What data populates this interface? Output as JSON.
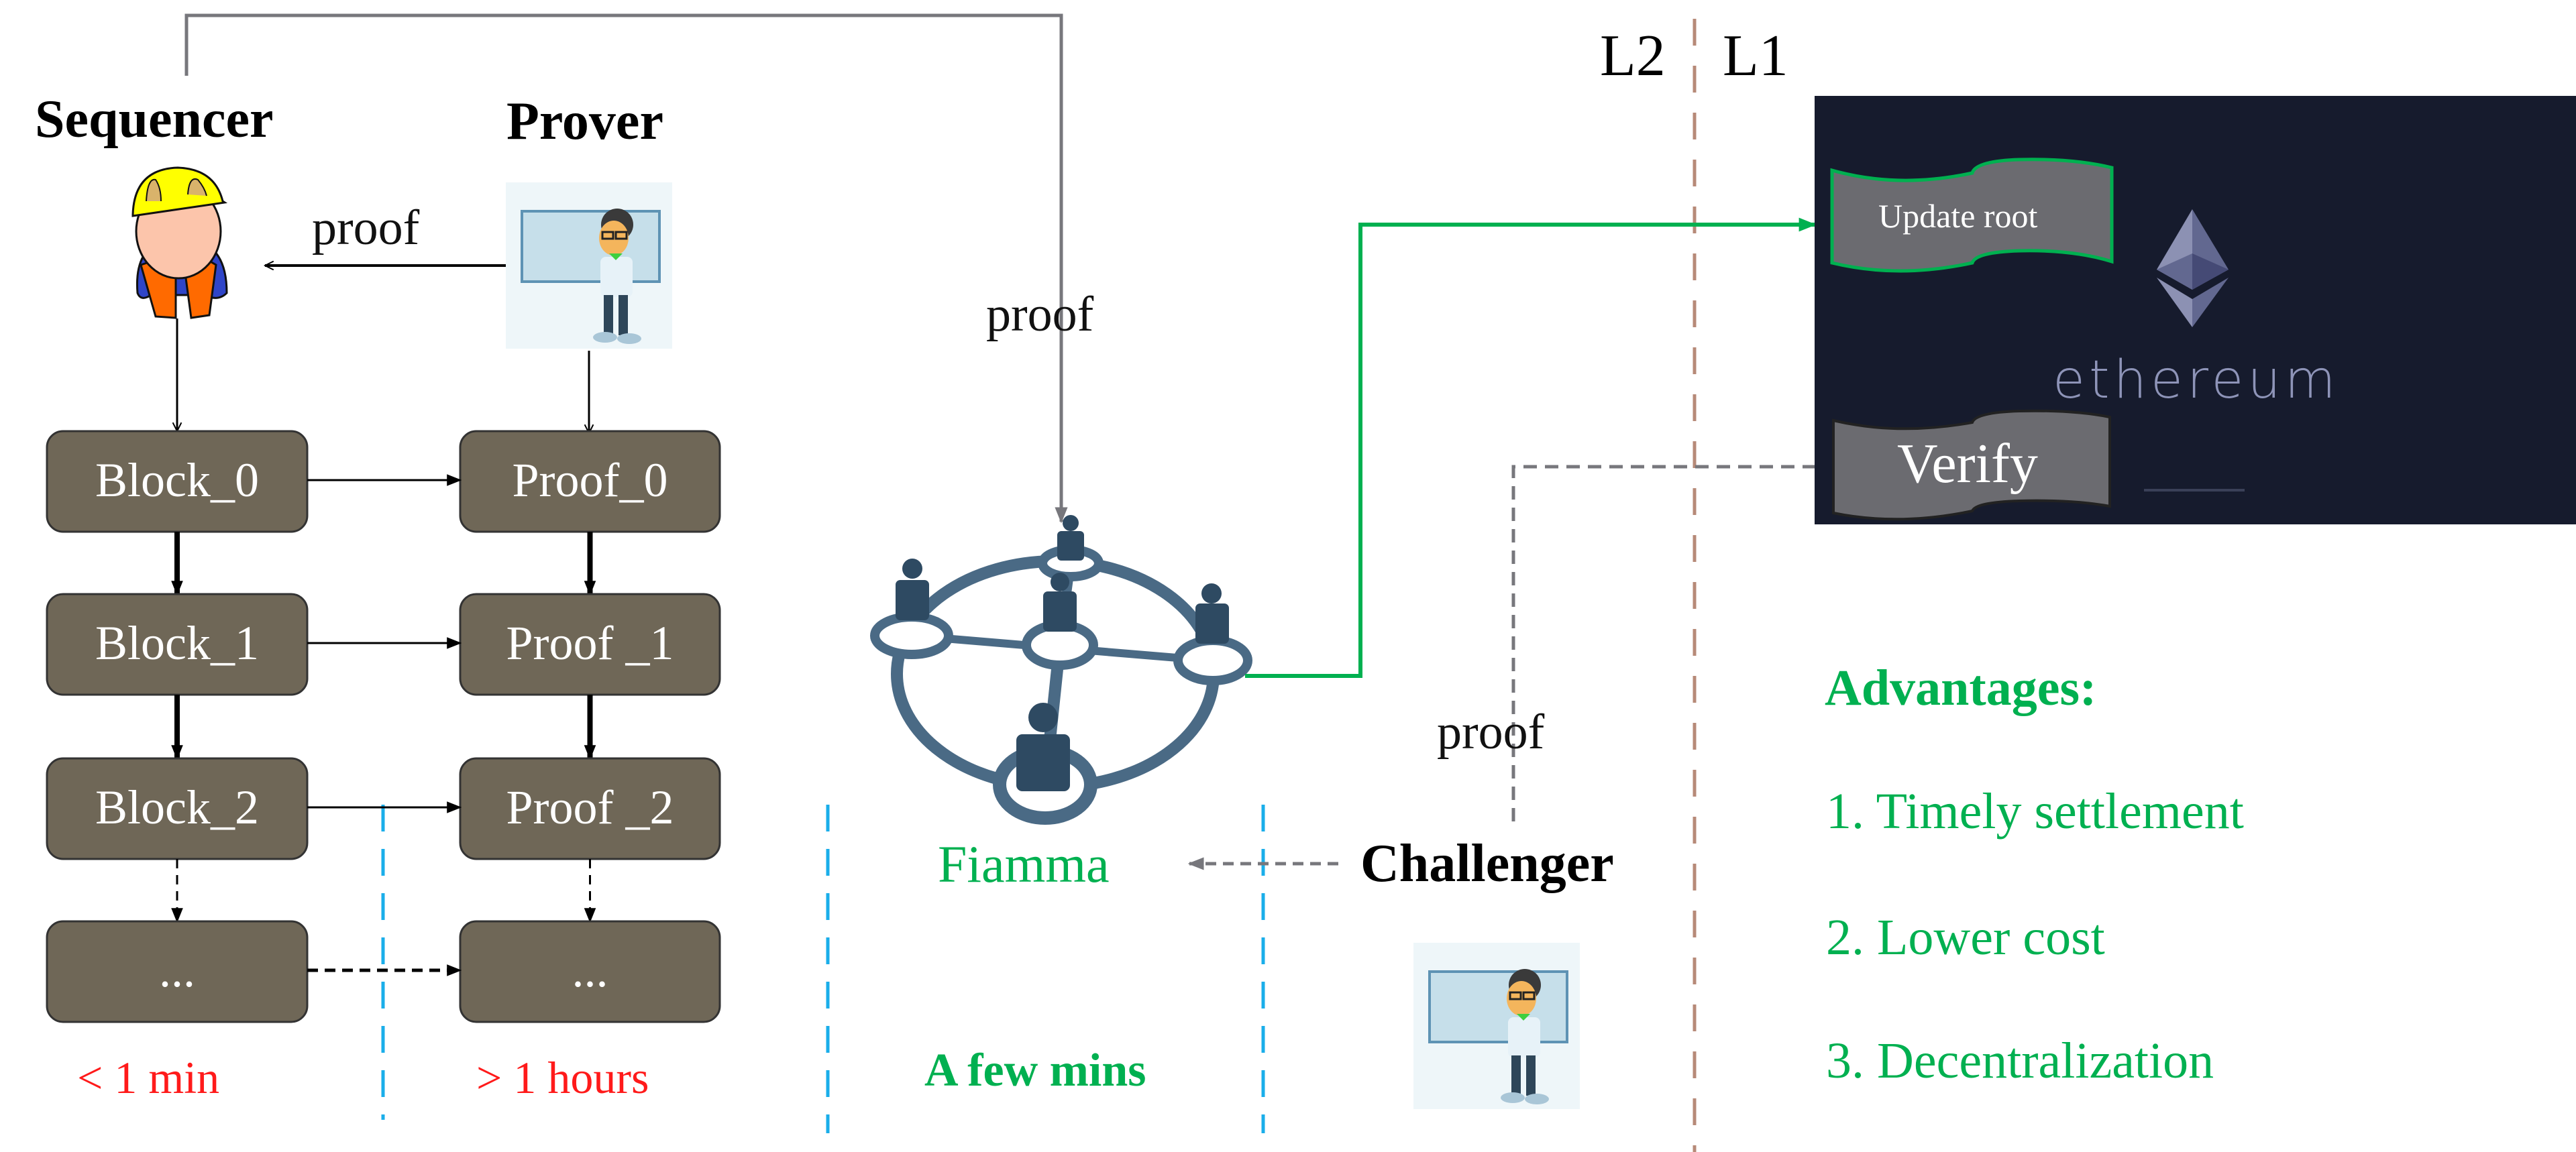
{
  "roles": {
    "sequencer": "Sequencer",
    "prover": "Prover",
    "challenger": "Challenger"
  },
  "edge_labels": {
    "prover_to_sequencer": "proof",
    "sequencer_to_fiamma": "proof",
    "challenger_to_l1": "proof"
  },
  "block_column": {
    "boxes": [
      "Block_0",
      "Block_1",
      "Block_2",
      "..."
    ],
    "timing": "< 1 min"
  },
  "proof_column": {
    "boxes": [
      "Proof_0",
      "Proof _1",
      "Proof _2",
      "..."
    ],
    "timing": "> 1 hours"
  },
  "fiamma": {
    "label": "Fiamma",
    "timing": "A few mins"
  },
  "layers": {
    "left": "L2",
    "right": "L1"
  },
  "ethereum_panel": {
    "update_root": "Update root",
    "verify": "Verify",
    "wordmark": "ethereum"
  },
  "advantages": {
    "title": "Advantages:",
    "items": [
      "1. Timely settlement",
      "2. Lower cost",
      "3. Decentralization"
    ]
  },
  "colors": {
    "box_fill": "#6f6757",
    "green": "#00b050",
    "red": "#ff1a1a",
    "blue_divider": "#1aaeea",
    "layer_divider": "#b78a78",
    "eth_bg": "#161b2d",
    "banner_fill": "#6b6b70",
    "network": "#4a6a85"
  }
}
